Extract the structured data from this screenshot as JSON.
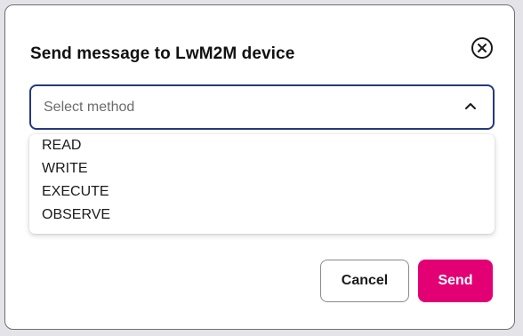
{
  "modal": {
    "title": "Send message to LwM2M device",
    "close_icon": "close-circle-icon"
  },
  "method_select": {
    "placeholder": "Select method",
    "chevron_icon": "chevron-up-icon",
    "options": [
      "READ",
      "WRITE",
      "EXECUTE",
      "OBSERVE"
    ]
  },
  "footer": {
    "cancel_label": "Cancel",
    "send_label": "Send"
  },
  "colors": {
    "accent": "#e20074",
    "select_border": "#26397a"
  }
}
